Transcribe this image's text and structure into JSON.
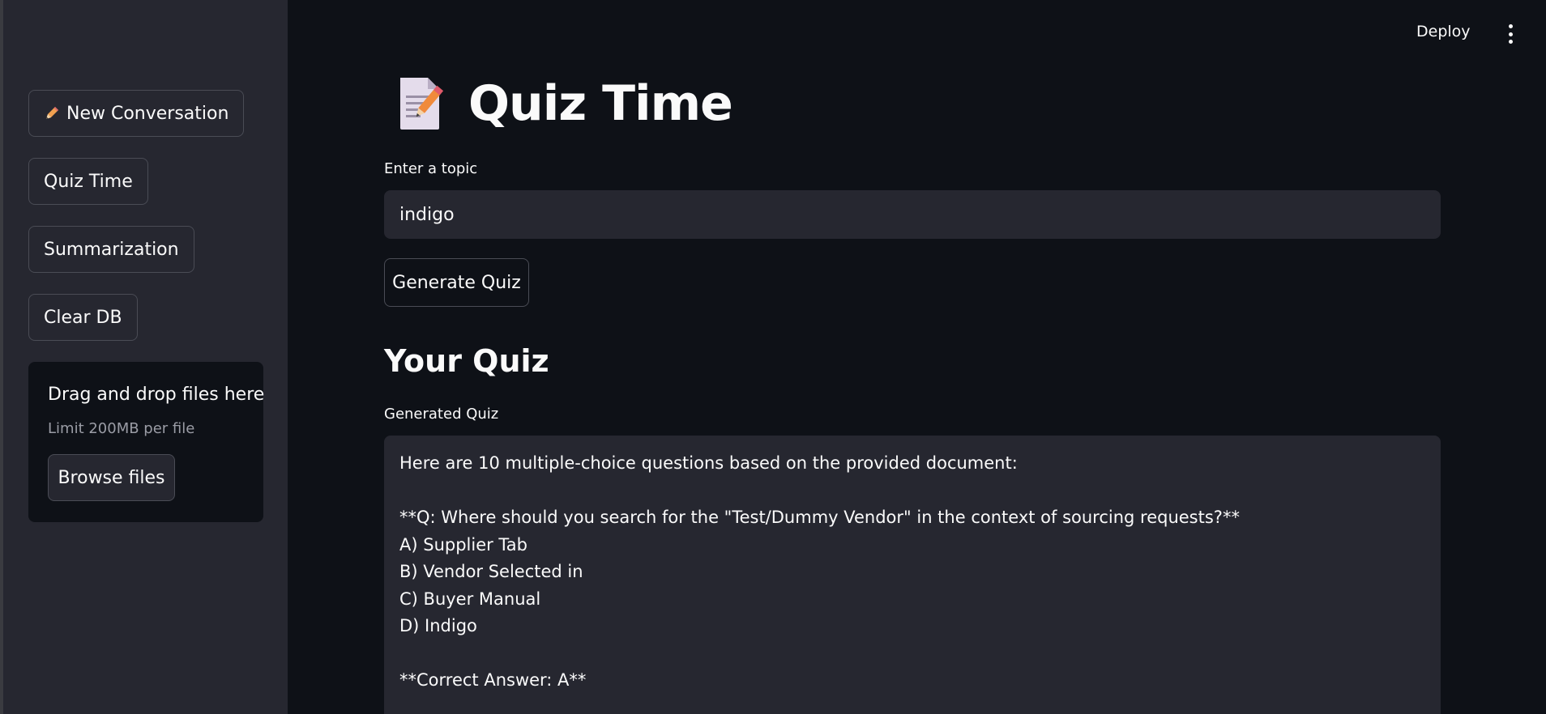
{
  "sidebar": {
    "buttons": [
      {
        "label": "New Conversation",
        "icon": "pencil-icon"
      },
      {
        "label": "Quiz Time"
      },
      {
        "label": "Summarization"
      },
      {
        "label": "Clear DB"
      }
    ],
    "uploader": {
      "title": "Drag and drop files here",
      "limit": "Limit 200MB per file",
      "button_label": "Browse files"
    }
  },
  "header": {
    "deploy_label": "Deploy",
    "menu_icon": "kebab-menu-icon"
  },
  "main": {
    "title": "Quiz Time",
    "title_icon": "memo-icon",
    "topic_label": "Enter a topic",
    "topic_value": "indigo",
    "generate_button": "Generate Quiz",
    "section_heading": "Your Quiz",
    "quiz_label": "Generated Quiz",
    "quiz_text": "Here are 10 multiple-choice questions based on the provided document:\n\n**Q: Where should you search for the \"Test/Dummy Vendor\" in the context of sourcing requests?**\nA) Supplier Tab\nB) Vendor Selected in\nC) Buyer Manual\nD) Indigo\n\n**Correct Answer: A**"
  },
  "colors": {
    "background": "#0e1117",
    "sidebar": "#262730",
    "input": "#262730",
    "border": "#4a4c55",
    "text": "#fafafa",
    "muted": "#9a9ca5"
  }
}
